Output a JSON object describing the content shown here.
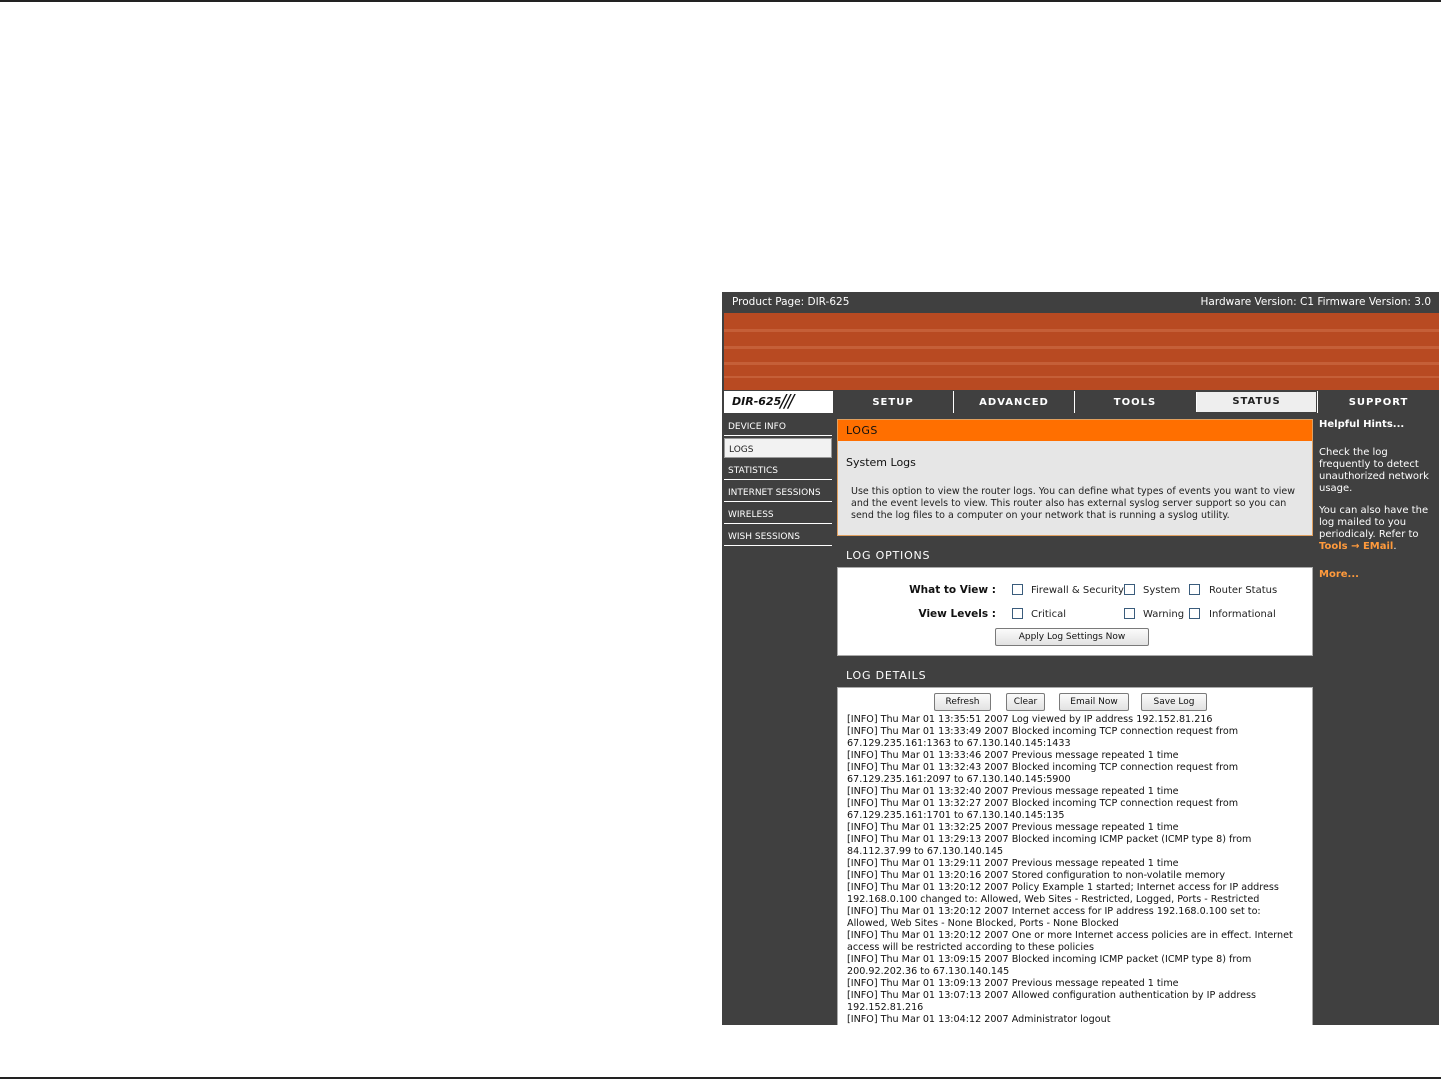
{
  "header": {
    "product": "Product Page: DIR-625",
    "versions": "Hardware Version: C1   Firmware Version: 3.0"
  },
  "brand": {
    "logo": "DIR-625",
    "slashes": "///"
  },
  "tabs": [
    {
      "label": "SETUP"
    },
    {
      "label": "ADVANCED"
    },
    {
      "label": "TOOLS"
    },
    {
      "label": "STATUS"
    },
    {
      "label": "SUPPORT"
    }
  ],
  "sidebar": {
    "items": [
      {
        "label": "DEVICE INFO"
      },
      {
        "label": "LOGS"
      },
      {
        "label": "STATISTICS"
      },
      {
        "label": "INTERNET SESSIONS"
      },
      {
        "label": "WIRELESS"
      },
      {
        "label": "WISH SESSIONS"
      }
    ]
  },
  "logs": {
    "title": "LOGS",
    "subtitle": "System Logs",
    "description": "Use this option to view the router logs. You can define what types of events you want to view and the event levels to view. This router also has external syslog server support so you can send the log files to a computer on your network that is running a syslog utility."
  },
  "options": {
    "title": "LOG OPTIONS",
    "what_label": "What to View :",
    "levels_label": "View Levels :",
    "view_firewall": "Firewall & Security",
    "view_system": "System",
    "view_router": "Router Status",
    "level_critical": "Critical",
    "level_warning": "Warning",
    "level_info": "Informational",
    "apply_button": "Apply Log Settings Now"
  },
  "details": {
    "title": "LOG DETAILS",
    "buttons": {
      "refresh": "Refresh",
      "clear": "Clear",
      "email": "Email Now",
      "save": "Save Log"
    },
    "lines": [
      "[INFO] Thu Mar 01 13:35:51 2007 Log viewed by IP address 192.152.81.216",
      "[INFO] Thu Mar 01 13:33:49 2007 Blocked incoming TCP connection request from",
      "67.129.235.161:1363 to 67.130.140.145:1433",
      "[INFO] Thu Mar 01 13:33:46 2007 Previous message repeated 1 time",
      "[INFO] Thu Mar 01 13:32:43 2007 Blocked incoming TCP connection request from",
      "67.129.235.161:2097 to 67.130.140.145:5900",
      "[INFO] Thu Mar 01 13:32:40 2007 Previous message repeated 1 time",
      "[INFO] Thu Mar 01 13:32:27 2007 Blocked incoming TCP connection request from",
      "67.129.235.161:1701 to 67.130.140.145:135",
      "[INFO] Thu Mar 01 13:32:25 2007 Previous message repeated 1 time",
      "[INFO] Thu Mar 01 13:29:13 2007 Blocked incoming ICMP packet (ICMP type 8) from",
      "84.112.37.99 to 67.130.140.145",
      "[INFO] Thu Mar 01 13:29:11 2007 Previous message repeated 1 time",
      "[INFO] Thu Mar 01 13:20:16 2007 Stored configuration to non-volatile memory",
      "[INFO] Thu Mar 01 13:20:12 2007 Policy Example 1 started; Internet access for IP address",
      "192.168.0.100 changed to: Allowed, Web Sites - Restricted, Logged, Ports - Restricted",
      "[INFO] Thu Mar 01 13:20:12 2007 Internet access for IP address 192.168.0.100 set to:",
      "Allowed, Web Sites - None Blocked, Ports - None Blocked",
      "[INFO] Thu Mar 01 13:20:12 2007 One or more Internet access policies are in effect. Internet",
      "access will be restricted according to these policies",
      "[INFO] Thu Mar 01 13:09:15 2007 Blocked incoming ICMP packet (ICMP type 8) from",
      "200.92.202.36 to 67.130.140.145",
      "[INFO] Thu Mar 01 13:09:13 2007 Previous message repeated 1 time",
      "[INFO] Thu Mar 01 13:07:13 2007 Allowed configuration authentication by IP address",
      "192.152.81.216",
      "[INFO] Thu Mar 01 13:04:12 2007 Administrator logout"
    ]
  },
  "hints": {
    "title": "Helpful Hints...",
    "text1": "Check the log frequently to detect unauthorized network usage.",
    "text2": "You can also have the log mailed to you periodicaly. Refer to",
    "link": "Tools → EMail",
    "link_suffix": ".",
    "more": "More..."
  },
  "colors": {
    "banner": "#b84a22",
    "orange_header": "#ff6f00",
    "dark_bg": "#404040",
    "hint_link": "#ff9a3c"
  }
}
